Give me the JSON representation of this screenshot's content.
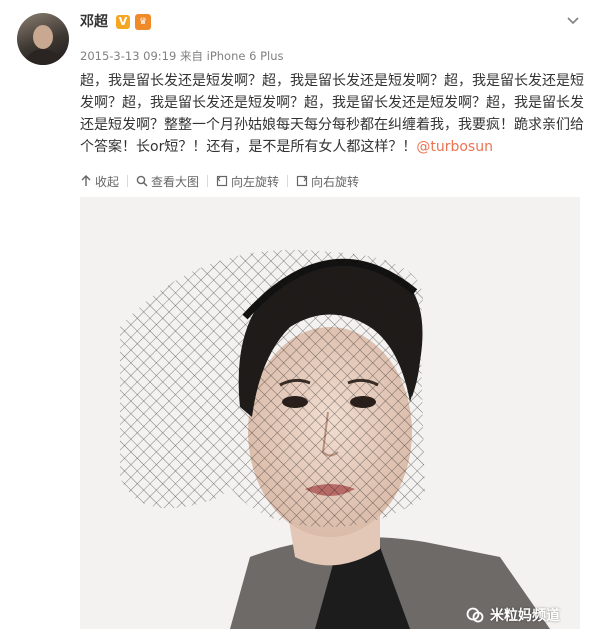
{
  "post": {
    "author": "邓超",
    "verified_badge": "V",
    "timestamp": "2015-3-13 09:19",
    "source_prefix": "来自",
    "source_device": "iPhone 6 Plus",
    "text_main": "超，我是留长发还是短发啊？超，我是留长发还是短发啊？超，我是留长发还是短发啊？超，我是留长发还是短发啊？超，我是留长发还是短发啊？超，我是留长发还是短发啊？整整一个月孙姑娘每天每分每秒都在纠缠着我，我要疯！跪求亲们给个答案！长or短？！还有，是不是所有女人都这样？！",
    "mention": "@turbosun"
  },
  "toolbar": {
    "collapse": "收起",
    "view_large": "查看大图",
    "rotate_left": "向左旋转",
    "rotate_right": "向右旋转"
  },
  "watermark": {
    "text": "米粒妈频道"
  },
  "icons": {
    "avatar": "user-avatar",
    "verified": "verified-v-icon",
    "member": "crown-icon",
    "menu": "chevron-down-icon",
    "collapse": "arrow-up-icon",
    "view": "search-icon",
    "rotate_left": "rotate-left-icon",
    "rotate_right": "rotate-right-icon",
    "watermark": "wechat-channel-icon"
  },
  "colors": {
    "mention": "#eb7350",
    "text": "#333333",
    "meta": "#808080",
    "badge": "#f5a623"
  }
}
